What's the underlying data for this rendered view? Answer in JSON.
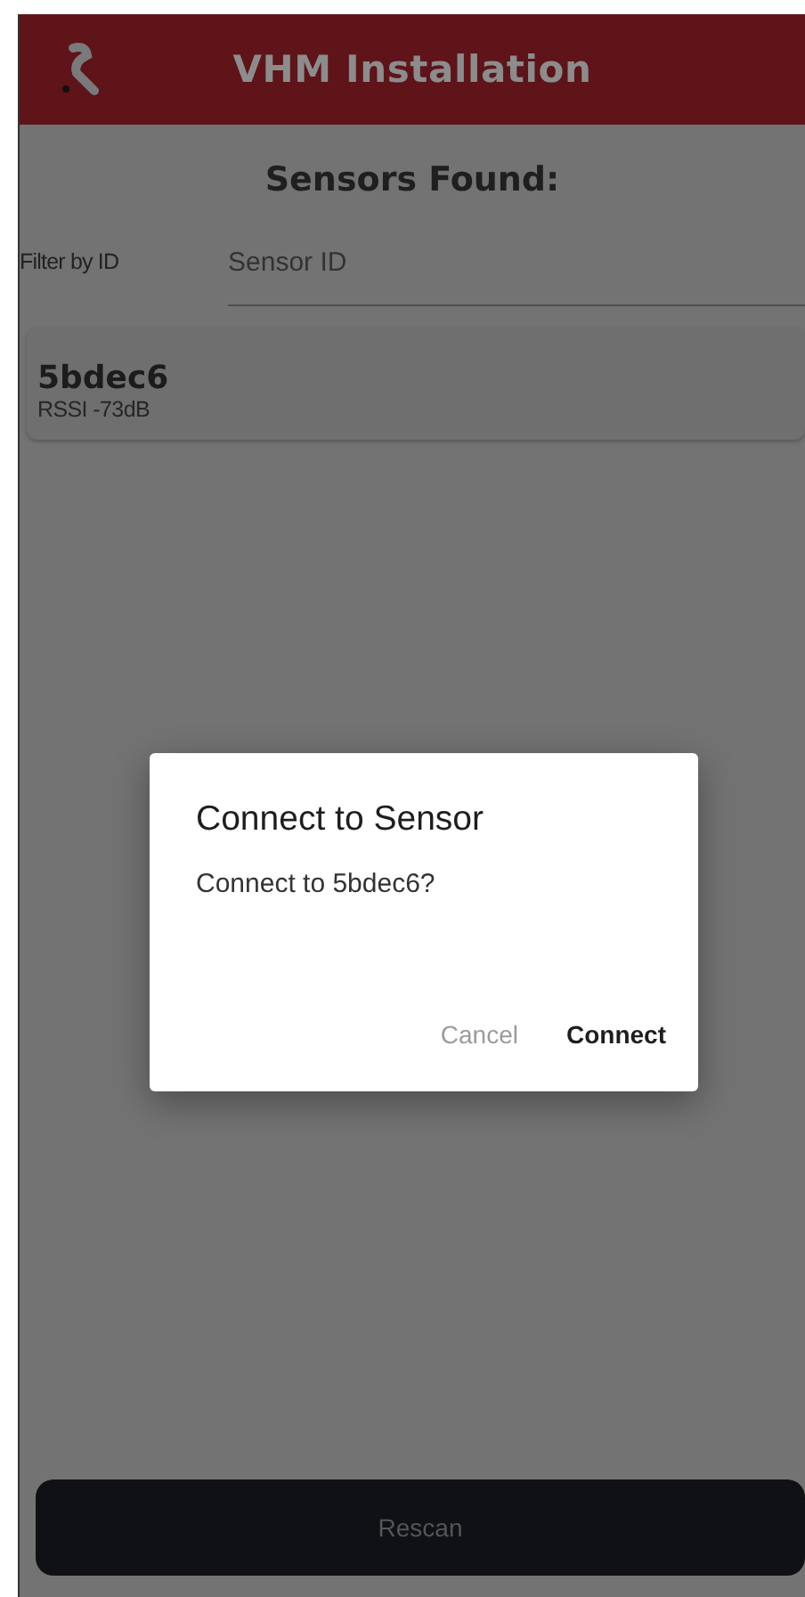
{
  "app_bar": {
    "title": "VHM Installation"
  },
  "heading": "Sensors Found:",
  "filter": {
    "label": "Filter by ID",
    "placeholder": "Sensor ID"
  },
  "sensors": [
    {
      "id": "5bdec6",
      "rssi": "RSSI -73dB"
    }
  ],
  "rescan_button": "Rescan",
  "dialog": {
    "title": "Connect to Sensor",
    "message": "Connect to 5bdec6?",
    "actions": [
      {
        "label": "Cancel",
        "kind": "dismiss"
      },
      {
        "label": "Connect",
        "kind": "confirm"
      }
    ]
  }
}
